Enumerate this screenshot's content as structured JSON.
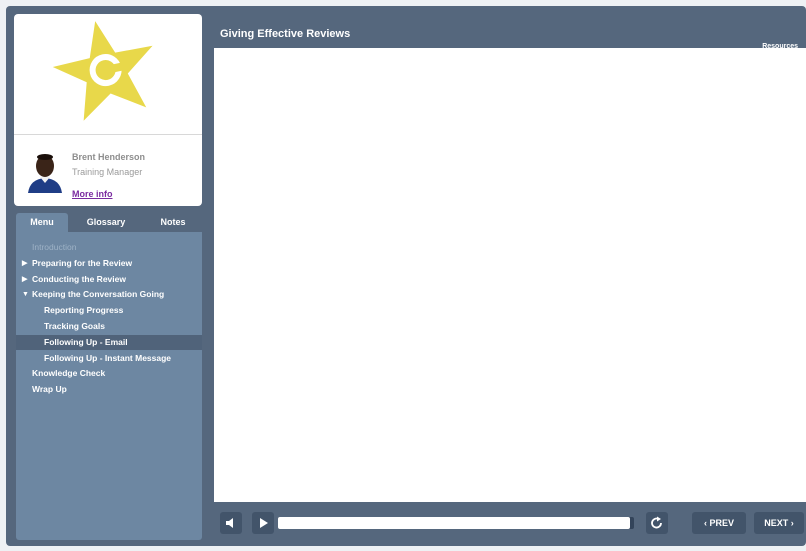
{
  "course": {
    "title": "Giving Effective Reviews",
    "resources_label": "Resources"
  },
  "presenter": {
    "name": "Brent Henderson",
    "role": "Training Manager",
    "more_info_label": "More info",
    "logo_icon": "star-logo-icon",
    "logo_color": "#e8d84a"
  },
  "tabs": [
    {
      "label": "Menu",
      "active": true
    },
    {
      "label": "Glossary",
      "active": false
    },
    {
      "label": "Notes",
      "active": false
    }
  ],
  "menu": [
    {
      "label": "Introduction",
      "level": 0,
      "state": "disabled"
    },
    {
      "label": "Preparing for the Review",
      "level": 0,
      "expander": "collapsed"
    },
    {
      "label": "Conducting the Review",
      "level": 0,
      "expander": "collapsed"
    },
    {
      "label": "Keeping the Conversation Going",
      "level": 0,
      "expander": "expanded"
    },
    {
      "label": "Reporting Progress",
      "level": 1
    },
    {
      "label": "Tracking Goals",
      "level": 1
    },
    {
      "label": "Following Up - Email",
      "level": 1,
      "state": "selected"
    },
    {
      "label": "Following Up - Instant Message",
      "level": 1
    },
    {
      "label": "Knowledge Check",
      "level": 0
    },
    {
      "label": "Wrap Up",
      "level": 0
    }
  ],
  "player": {
    "progress_fraction": 0.99,
    "prev_label": "‹ PREV",
    "next_label": "NEXT ›",
    "icons": [
      "volume-icon",
      "play-icon",
      "replay-icon"
    ],
    "accent_color": "#55677d"
  }
}
